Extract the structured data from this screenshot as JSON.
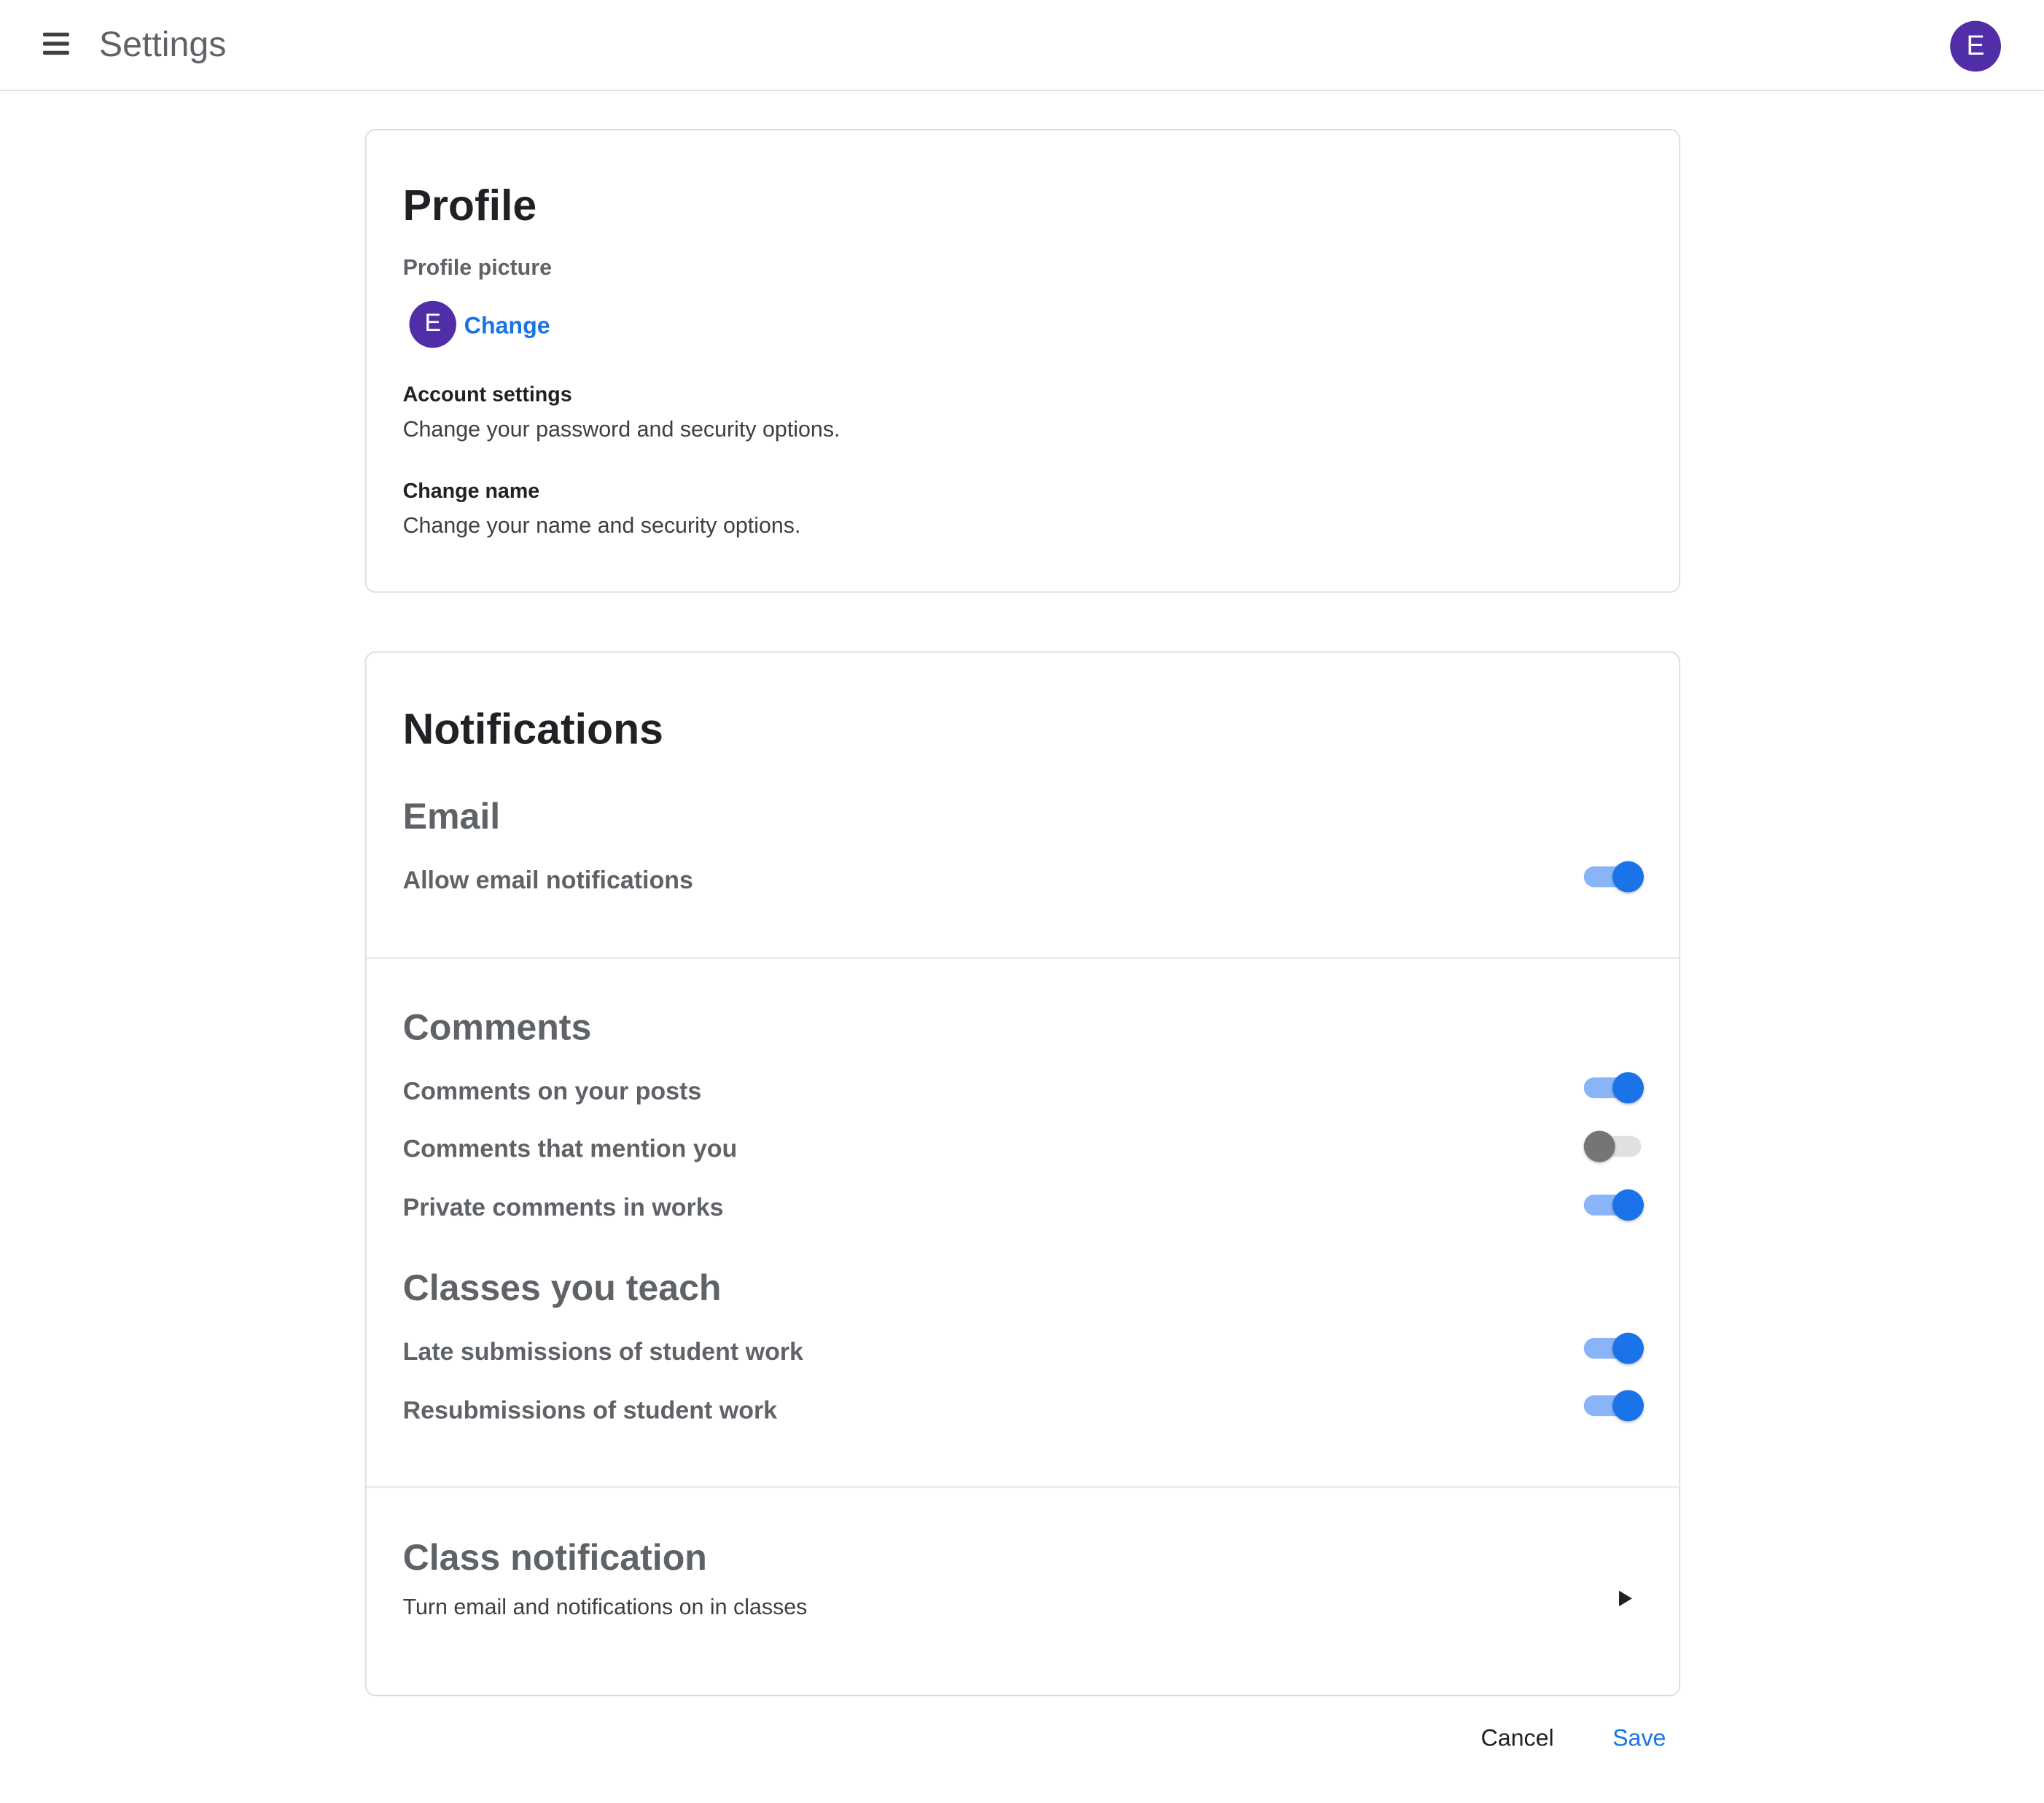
{
  "header": {
    "title": "Settings",
    "avatar_letter": "E",
    "menu_icon": "menu-icon"
  },
  "profile": {
    "heading": "Profile",
    "picture_label": "Profile picture",
    "avatar_letter": "E",
    "change_link": "Change",
    "account_settings": {
      "title": "Account settings",
      "description": "Change your password and security options."
    },
    "change_name": {
      "title": "Change name",
      "description": "Change your name and security options."
    }
  },
  "notifications": {
    "heading": "Notifications",
    "email": {
      "heading": "Email",
      "items": [
        {
          "label": "Allow email notifications",
          "enabled": true
        }
      ]
    },
    "comments": {
      "heading": "Comments",
      "items": [
        {
          "label": "Comments on your posts",
          "enabled": true
        },
        {
          "label": "Comments that mention you",
          "enabled": false
        },
        {
          "label": "Private comments in works",
          "enabled": true
        }
      ]
    },
    "classes": {
      "heading": "Classes you teach",
      "items": [
        {
          "label": "Late submissions of student work",
          "enabled": true
        },
        {
          "label": "Resubmissions of student work",
          "enabled": true
        }
      ]
    },
    "class_notification": {
      "heading": "Class notification",
      "description": "Turn email and notifications on in classes",
      "icon": "play-arrow-icon"
    }
  },
  "footer": {
    "cancel_label": "Cancel",
    "save_label": "Save"
  },
  "colors": {
    "accent": "#1a73e8",
    "toggle_track_on": "#8ab4f8",
    "avatar": "#512da8",
    "toggle_off_thumb": "#757575"
  }
}
